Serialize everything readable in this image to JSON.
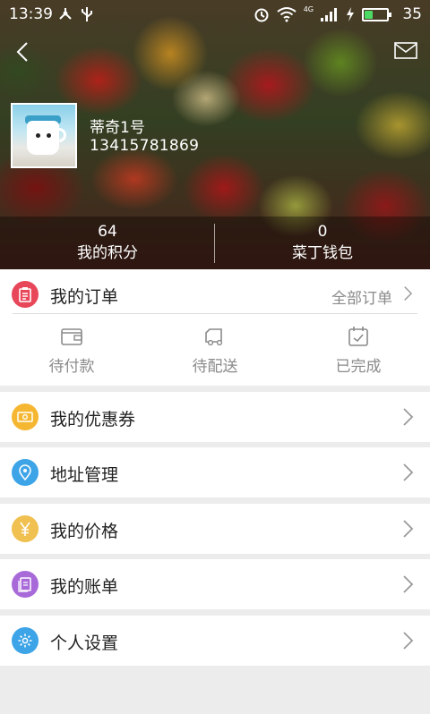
{
  "status_bar": {
    "time": "13:39",
    "network": "4G",
    "battery": "35",
    "battery_level": 0.35
  },
  "header": {
    "back_icon": "back-chevron-icon",
    "mail_icon": "mail-icon"
  },
  "profile": {
    "name": "蒂奇1号",
    "phone": "13415781869"
  },
  "stats": {
    "points_value": "64",
    "points_label": "我的积分",
    "wallet_value": "0",
    "wallet_label": "菜丁钱包"
  },
  "orders": {
    "title": "我的订单",
    "all_link": "全部订单",
    "tabs": [
      {
        "label": "待付款",
        "icon": "wallet-icon"
      },
      {
        "label": "待配送",
        "icon": "truck-icon"
      },
      {
        "label": "已完成",
        "icon": "calendar-check-icon"
      }
    ]
  },
  "menu": [
    {
      "label": "我的优惠券",
      "icon": "coupon-icon",
      "color": "#f5b731"
    },
    {
      "label": "地址管理",
      "icon": "location-pin-icon",
      "color": "#3ea4e8"
    },
    {
      "label": "我的价格",
      "icon": "yen-icon",
      "color": "#f0c050"
    },
    {
      "label": "我的账单",
      "icon": "document-icon",
      "color": "#a86ad9"
    },
    {
      "label": "个人设置",
      "icon": "gear-icon",
      "color": "#3ea4e8"
    }
  ],
  "colors": {
    "orders_icon": "#e8475a",
    "page_bg": "#ececec",
    "secondary_text": "#8a8a8a"
  }
}
